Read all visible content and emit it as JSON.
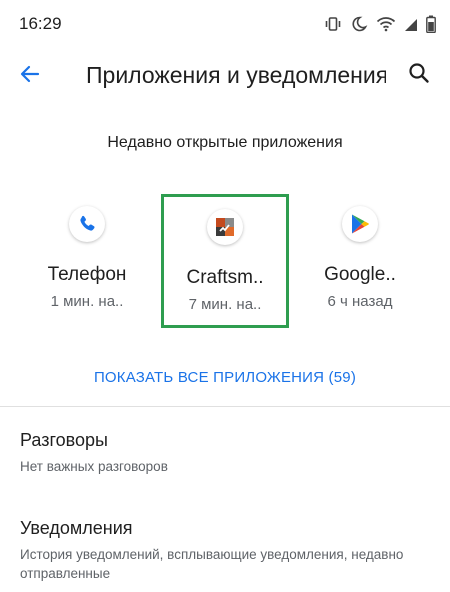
{
  "status_bar": {
    "time": "16:29",
    "icons": [
      "vibrate-icon",
      "do-not-disturb-moon-icon",
      "wifi-icon",
      "signal-icon",
      "battery-icon"
    ]
  },
  "toolbar": {
    "title": "Приложения и уведомления",
    "back_icon": "arrow-back-icon",
    "search_icon": "search-icon"
  },
  "recent": {
    "header": "Недавно открытые приложения",
    "apps": [
      {
        "name": "Телефон",
        "time": "1 мин. на..",
        "icon": "phone-icon"
      },
      {
        "name": "Craftsm..",
        "time": "7 мин. на..",
        "icon": "craftsman-app-icon"
      },
      {
        "name": "Google..",
        "time": "6 ч назад",
        "icon": "google-play-icon"
      }
    ],
    "show_all": "ПОКАЗАТЬ ВСЕ ПРИЛОЖЕНИЯ (59)"
  },
  "settings": [
    {
      "title": "Разговоры",
      "subtitle": "Нет важных разговоров"
    },
    {
      "title": "Уведомления",
      "subtitle": "История уведомлений, всплывающие уведомления, недавно отправленные"
    }
  ],
  "colors": {
    "accent": "#1a73e8",
    "selection_border": "#2e9d4f",
    "text_primary": "#1f1f1f",
    "text_secondary": "#5f6368"
  }
}
